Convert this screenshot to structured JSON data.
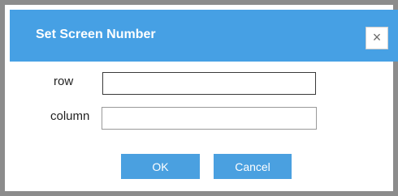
{
  "dialog": {
    "title": "Set Screen Number",
    "close_symbol": "×",
    "close_icon": "close-icon"
  },
  "form": {
    "row_label": "row",
    "row_value": "",
    "column_label": "column",
    "column_value": ""
  },
  "buttons": {
    "ok_label": "OK",
    "cancel_label": "Cancel"
  },
  "colors": {
    "titlebar": "#46a0e4",
    "button": "#4aa0e0",
    "frame": "#8c8c8c"
  }
}
